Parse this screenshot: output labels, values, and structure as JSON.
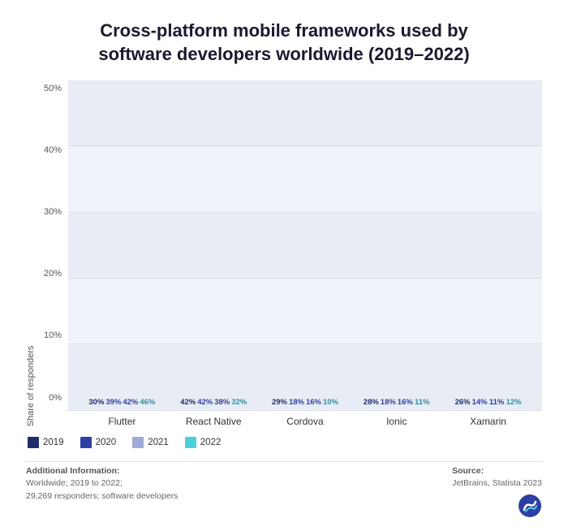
{
  "title": "Cross-platform mobile frameworks used by\nsoftware developers worldwide (2019–2022)",
  "yAxis": {
    "labels": [
      "50%",
      "40%",
      "30%",
      "20%",
      "10%",
      "0%"
    ],
    "max": 50
  },
  "legend": {
    "items": [
      {
        "year": "2019",
        "color": "#1e2d6b"
      },
      {
        "year": "2020",
        "color": "#2e3fa3"
      },
      {
        "year": "2021",
        "color": "#a0aad4"
      },
      {
        "year": "2022",
        "color": "#4dcfda"
      }
    ]
  },
  "groups": [
    {
      "label": "Flutter",
      "bars": [
        {
          "value": 30,
          "color": "#1e2d6b",
          "label": "30%"
        },
        {
          "value": 39,
          "color": "#2e3fa3",
          "label": "39%"
        },
        {
          "value": 42,
          "color": "#a0aad4",
          "label": "42%"
        },
        {
          "value": 46,
          "color": "#4dcfda",
          "label": "46%"
        }
      ]
    },
    {
      "label": "React Native",
      "bars": [
        {
          "value": 42,
          "color": "#1e2d6b",
          "label": "42%"
        },
        {
          "value": 42,
          "color": "#2e3fa3",
          "label": "42%"
        },
        {
          "value": 38,
          "color": "#a0aad4",
          "label": "38%"
        },
        {
          "value": 32,
          "color": "#4dcfda",
          "label": "32%"
        }
      ]
    },
    {
      "label": "Cordova",
      "bars": [
        {
          "value": 29,
          "color": "#1e2d6b",
          "label": "29%"
        },
        {
          "value": 18,
          "color": "#2e3fa3",
          "label": "18%"
        },
        {
          "value": 16,
          "color": "#a0aad4",
          "label": "16%"
        },
        {
          "value": 10,
          "color": "#4dcfda",
          "label": "10%"
        }
      ]
    },
    {
      "label": "Ionic",
      "bars": [
        {
          "value": 28,
          "color": "#1e2d6b",
          "label": "28%"
        },
        {
          "value": 18,
          "color": "#2e3fa3",
          "label": "18%"
        },
        {
          "value": 16,
          "color": "#a0aad4",
          "label": "16%"
        },
        {
          "value": 11,
          "color": "#4dcfda",
          "label": "11%"
        }
      ]
    },
    {
      "label": "Xamarin",
      "bars": [
        {
          "value": 26,
          "color": "#1e2d6b",
          "label": "26%"
        },
        {
          "value": 14,
          "color": "#2e3fa3",
          "label": "14%"
        },
        {
          "value": 11,
          "color": "#a0aad4",
          "label": "11%"
        },
        {
          "value": 12,
          "color": "#4dcfda",
          "label": "12%"
        }
      ]
    }
  ],
  "footer": {
    "left_label": "Additional Information:",
    "left_text": "Worldwide; 2019 to 2022;\n29,269 responders; software developers",
    "right_label": "Source:",
    "right_text": "JetBrains, Statista 2023"
  },
  "yAxisTitle": "Share of responders"
}
